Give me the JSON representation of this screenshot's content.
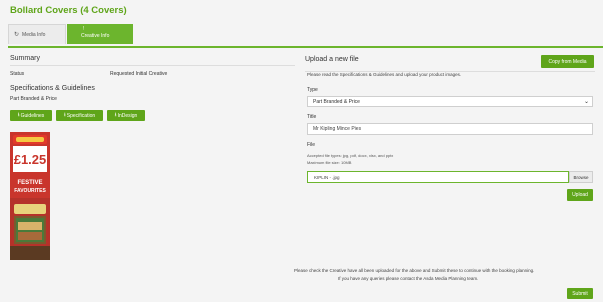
{
  "page": {
    "title": "Bollard Covers (4 Covers)"
  },
  "tabs": [
    {
      "label": "Media Info",
      "icon": "refresh-icon"
    },
    {
      "label": "Creative Info",
      "icon": "exclamation-icon"
    }
  ],
  "summary": {
    "heading": "Summary",
    "status_label": "Status",
    "status_value": "Requested Initial Creative"
  },
  "specs": {
    "heading": "Specifications & Guidelines",
    "text": "Part Branded & Price",
    "buttons": [
      {
        "label": "Guidelines",
        "icon": "download-icon"
      },
      {
        "label": "Specification",
        "icon": "download-icon"
      },
      {
        "label": "InDesign",
        "icon": "download-icon"
      }
    ]
  },
  "thumbnail": {
    "price": "£1.25",
    "banner": "FESTIVE FAVOURITES"
  },
  "upload": {
    "heading": "Upload a new file",
    "copy_button": "Copy from Media",
    "intro": "Please read the Specifications & Guidelines and upload your product images.",
    "type_label": "Type",
    "type_value": "Part Branded & Price",
    "title_label": "Title",
    "title_value": "Mr Kipling Mince Pies",
    "file_label": "File",
    "accept_text": "Accepted file types: jpg, pdf, docx, xlsx, and pptx",
    "max_size": "Maximum file size: 10MB",
    "file_name": "KIPLIN - .jpg",
    "browse_label": "Browse",
    "upload_button": "Upload"
  },
  "footer": {
    "notice_line1": "Please check the Creative have all been uploaded for the above and Submit these to continue with the booking planning.",
    "notice_line2": "If you have any queries please contact the Asda Media Planning team.",
    "submit_label": "Submit"
  },
  "colors": {
    "accent": "#5fa51a",
    "background": "#f4f4f4"
  }
}
